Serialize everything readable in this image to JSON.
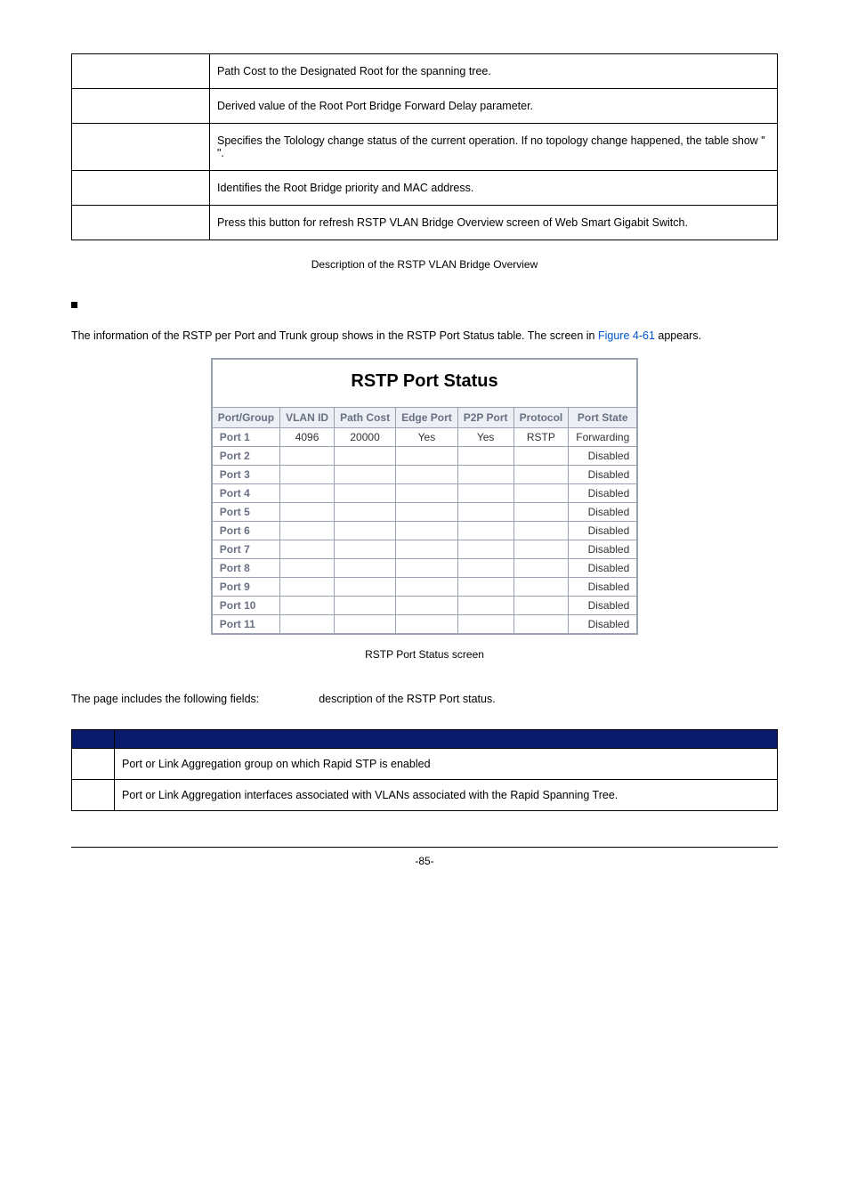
{
  "overview_rows": [
    {
      "label": "",
      "desc": "Path Cost to the Designated Root for the spanning tree."
    },
    {
      "label": "",
      "desc": "Derived value of the Root Port Bridge Forward Delay parameter."
    },
    {
      "label": "",
      "desc": "Specifies the Tolology change status of the current operation. If no topology change happened, the table show \"        \"."
    },
    {
      "label": "",
      "desc": "Identifies the Root Bridge priority and MAC address."
    },
    {
      "label": "",
      "desc": "Press this button for refresh RSTP VLAN Bridge Overview screen of Web Smart Gigabit Switch."
    }
  ],
  "overview_caption": "Description of the RSTP VLAN Bridge Overview",
  "bullet_heading": "",
  "intro_text_pre": "The information of the RSTP per Port and Trunk group shows in the RSTP Port Status table. The screen in ",
  "intro_link": "Figure 4-61",
  "intro_text_post": " appears.",
  "rstp_title": "RSTP Port Status",
  "rstp_headers": [
    "Port/Group",
    "VLAN ID",
    "Path Cost",
    "Edge Port",
    "P2P Port",
    "Protocol",
    "Port State"
  ],
  "chart_data": {
    "type": "table",
    "title": "RSTP Port Status",
    "columns": [
      "Port/Group",
      "VLAN ID",
      "Path Cost",
      "Edge Port",
      "P2P Port",
      "Protocol",
      "Port State"
    ],
    "rows": [
      {
        "port": "Port 1",
        "vlan": "4096",
        "cost": "20000",
        "edge": "Yes",
        "p2p": "Yes",
        "proto": "RSTP",
        "state": "Forwarding"
      },
      {
        "port": "Port 2",
        "vlan": "",
        "cost": "",
        "edge": "",
        "p2p": "",
        "proto": "",
        "state": "Disabled"
      },
      {
        "port": "Port 3",
        "vlan": "",
        "cost": "",
        "edge": "",
        "p2p": "",
        "proto": "",
        "state": "Disabled"
      },
      {
        "port": "Port 4",
        "vlan": "",
        "cost": "",
        "edge": "",
        "p2p": "",
        "proto": "",
        "state": "Disabled"
      },
      {
        "port": "Port 5",
        "vlan": "",
        "cost": "",
        "edge": "",
        "p2p": "",
        "proto": "",
        "state": "Disabled"
      },
      {
        "port": "Port 6",
        "vlan": "",
        "cost": "",
        "edge": "",
        "p2p": "",
        "proto": "",
        "state": "Disabled"
      },
      {
        "port": "Port 7",
        "vlan": "",
        "cost": "",
        "edge": "",
        "p2p": "",
        "proto": "",
        "state": "Disabled"
      },
      {
        "port": "Port 8",
        "vlan": "",
        "cost": "",
        "edge": "",
        "p2p": "",
        "proto": "",
        "state": "Disabled"
      },
      {
        "port": "Port 9",
        "vlan": "",
        "cost": "",
        "edge": "",
        "p2p": "",
        "proto": "",
        "state": "Disabled"
      },
      {
        "port": "Port 10",
        "vlan": "",
        "cost": "",
        "edge": "",
        "p2p": "",
        "proto": "",
        "state": "Disabled"
      },
      {
        "port": "Port 11",
        "vlan": "",
        "cost": "",
        "edge": "",
        "p2p": "",
        "proto": "",
        "state": "Disabled"
      }
    ]
  },
  "rstp_caption": "RSTP Port Status screen",
  "fields_intro_left": "The page includes the following fields:",
  "fields_intro_right": "description of the RSTP Port status.",
  "fields_header_object": "",
  "fields_header_description": "",
  "fields_rows": [
    {
      "obj": "",
      "desc": "Port or Link Aggregation group on which Rapid STP is enabled"
    },
    {
      "obj": "",
      "desc": "Port or Link Aggregation interfaces associated with VLANs associated with the Rapid Spanning Tree."
    }
  ],
  "page_number": "-85-"
}
